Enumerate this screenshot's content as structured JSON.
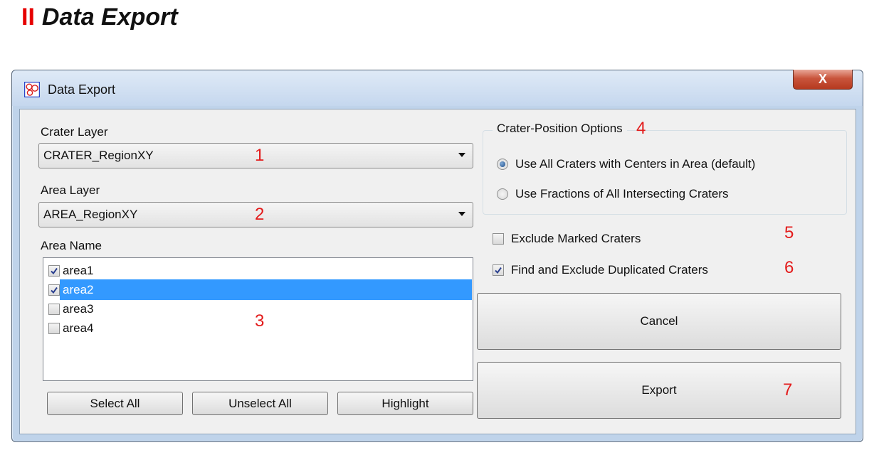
{
  "heading": {
    "roman_numeral": "II",
    "title": "Data Export"
  },
  "window": {
    "title": "Data Export",
    "close_label": "X",
    "crater_layer": {
      "label": "Crater Layer",
      "value": "CRATER_RegionXY",
      "annotation": "1"
    },
    "area_layer": {
      "label": "Area Layer",
      "value": "AREA_RegionXY",
      "annotation": "2"
    },
    "area_name": {
      "label": "Area Name",
      "annotation": "3",
      "items": [
        {
          "label": "area1",
          "checked": true,
          "selected": false
        },
        {
          "label": "area2",
          "checked": true,
          "selected": true
        },
        {
          "label": "area3",
          "checked": false,
          "selected": false
        },
        {
          "label": "area4",
          "checked": false,
          "selected": false
        }
      ]
    },
    "buttons": {
      "select_all": "Select All",
      "unselect_all": "Unselect All",
      "highlight": "Highlight",
      "cancel": "Cancel",
      "export": "Export"
    },
    "position_options": {
      "title": "Crater-Position Options",
      "annotation": "4",
      "option_centers": "Use All Craters with Centers in Area (default)",
      "option_fractions": "Use Fractions of All Intersecting Craters",
      "selected": "option_centers"
    },
    "exclude_marked": {
      "label": "Exclude Marked Craters",
      "checked": false,
      "annotation": "5"
    },
    "exclude_duplicates": {
      "label": "Find and Exclude Duplicated Craters",
      "checked": true,
      "annotation": "6"
    },
    "export_annotation": "7"
  },
  "colors": {
    "annotation": "#e31b1b",
    "selection": "#3399ff",
    "close_button": "#c9553c"
  },
  "icons": {
    "app": "craters-app-icon",
    "check": "checkmark-icon",
    "dropdown": "chevron-down-icon"
  }
}
